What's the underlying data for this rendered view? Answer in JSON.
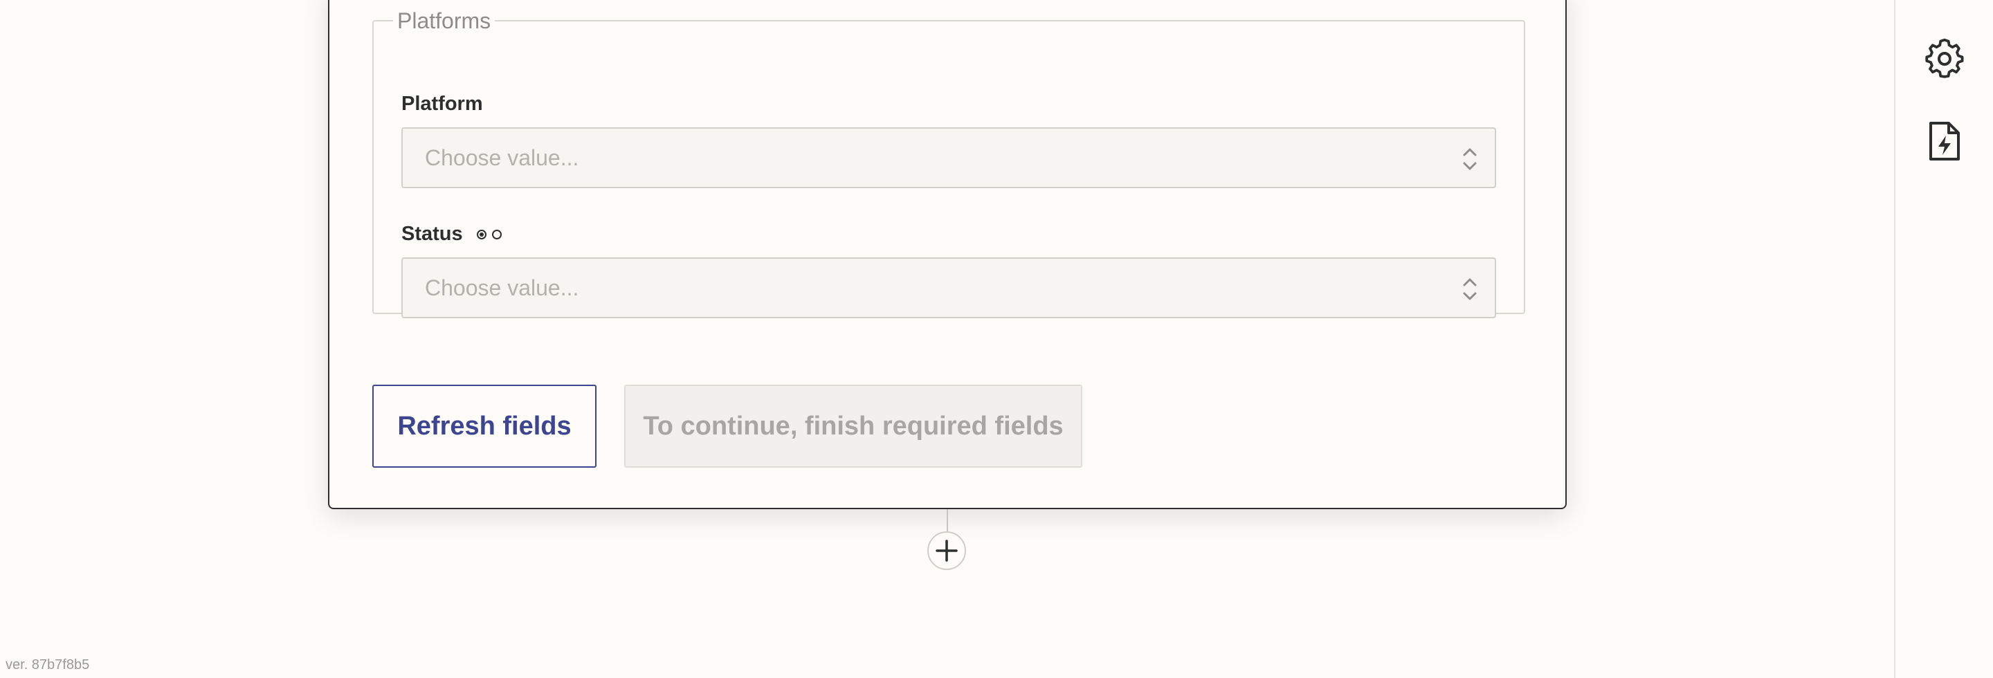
{
  "step": {
    "fieldset_legend": "Platforms",
    "fields": [
      {
        "label": "Platform",
        "placeholder": "Choose value..."
      },
      {
        "label": "Status",
        "placeholder": "Choose value..."
      }
    ],
    "refresh_button": "Refresh fields",
    "continue_button": "To continue, finish required fields"
  },
  "rail": {
    "icons": [
      "gear-icon",
      "bolt-file-icon"
    ]
  },
  "footer": {
    "version": "ver. 87b7f8b5"
  },
  "colors": {
    "accent": "#3d4591",
    "border_dark": "#2d2e2e",
    "background": "#fdfcf9"
  }
}
